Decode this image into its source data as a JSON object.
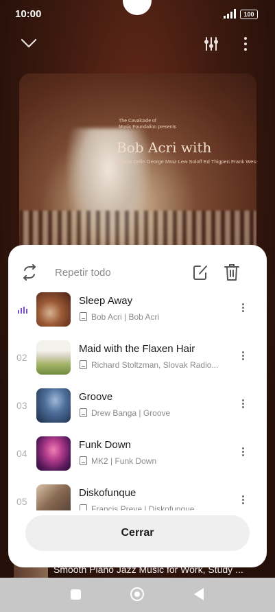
{
  "status": {
    "time": "10:00",
    "battery": "100"
  },
  "topbar": {
    "collapse_icon": "chevron-down-icon",
    "equalizer_icon": "equalizer-icon",
    "more_icon": "more-vert-icon"
  },
  "album_art": {
    "line1": "The Cavalcade of",
    "line2": "Music Foundation presents",
    "artist": "Bob Acri with",
    "credits": "Diane Delin George Mraz Lew Soloff Ed Thigpen Frank Wess"
  },
  "queue": {
    "repeat_label": "Repetir todo",
    "tracks": [
      {
        "number": "",
        "playing": true,
        "title": "Sleep Away",
        "subtitle": "Bob Acri | Bob Acri"
      },
      {
        "number": "02",
        "playing": false,
        "title": "Maid with the Flaxen Hair",
        "subtitle": "Richard Stoltzman, Slovak Radio..."
      },
      {
        "number": "03",
        "playing": false,
        "title": "Groove",
        "subtitle": "Drew Banga | Groove"
      },
      {
        "number": "04",
        "playing": false,
        "title": "Funk Down",
        "subtitle": "MK2 | Funk Down"
      },
      {
        "number": "05",
        "playing": false,
        "title": "Diskofunque",
        "subtitle": "Francis Preve | Diskofunque"
      }
    ],
    "close_label": "Cerrar"
  },
  "behind_sheet": {
    "title": "Smooth Piano Jazz Music for Work, Study ..."
  },
  "colors": {
    "accent": "#7b4fc9",
    "sheet": "#ffffff",
    "button": "#efefef"
  }
}
